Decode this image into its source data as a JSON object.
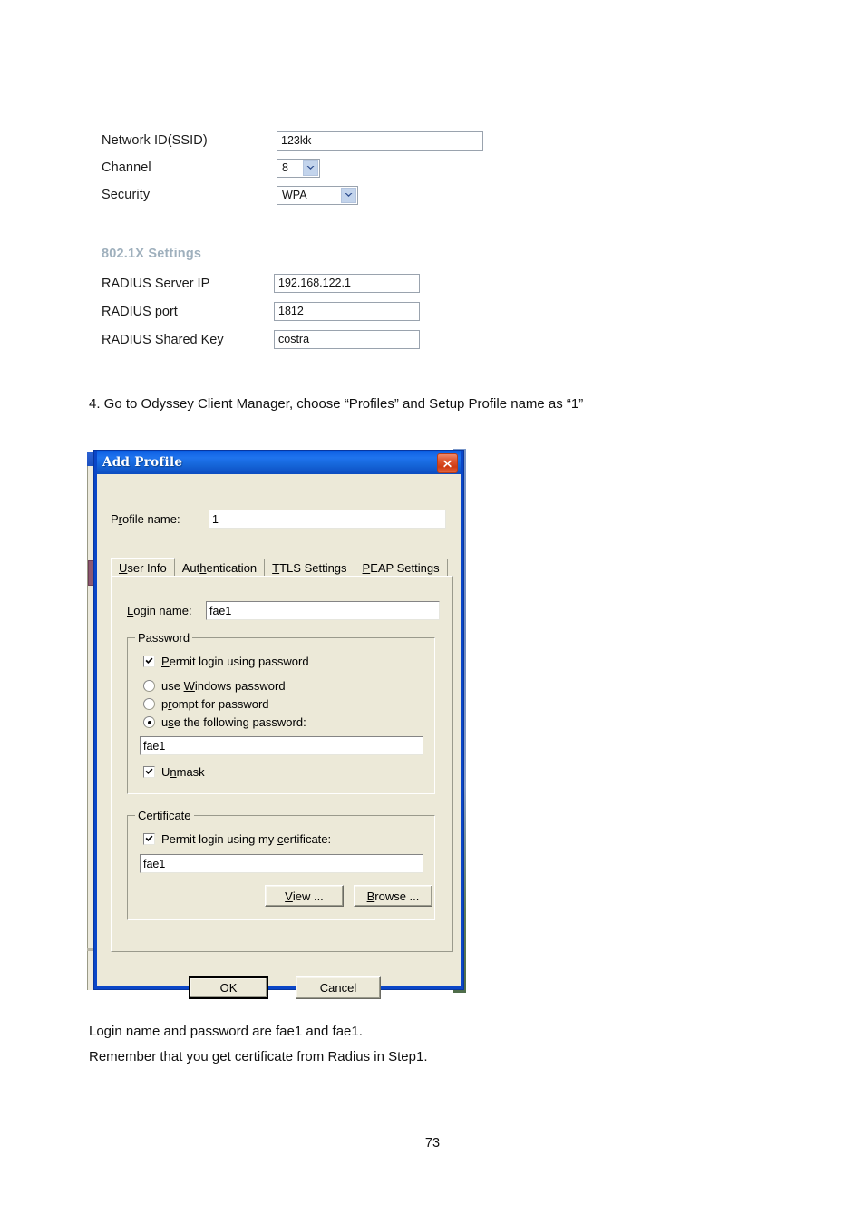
{
  "webform": {
    "rows": [
      {
        "label": "Network ID(SSID)",
        "type": "text",
        "value": "123kk"
      },
      {
        "label": "Channel",
        "type": "select",
        "value": "8"
      },
      {
        "label": "Security",
        "type": "select",
        "value": "WPA"
      }
    ]
  },
  "settings8021x": {
    "title": "802.1X Settings",
    "rows": [
      {
        "label": "RADIUS Server IP",
        "value": "192.168.122.1"
      },
      {
        "label": "RADIUS port",
        "value": "1812"
      },
      {
        "label": "RADIUS Shared Key",
        "value": "costra"
      }
    ]
  },
  "step": {
    "text": "4. Go to Odyssey Client Manager, choose “Profiles” and Setup Profile name as “1”"
  },
  "dialog": {
    "title": "Add Profile",
    "close_label": "Close",
    "profile_name": {
      "label": "Profile name:",
      "label_pre": "P",
      "label_mnemonic": "r",
      "label_post": "ofile name:",
      "value": "1"
    },
    "tabs": [
      {
        "pre": "",
        "mnemonic": "U",
        "post": "ser Info",
        "label": "User Info",
        "active": true
      },
      {
        "pre": "Aut",
        "mnemonic": "h",
        "post": "entication",
        "label": "Authentication",
        "active": false
      },
      {
        "pre": "",
        "mnemonic": "T",
        "post": "TLS Settings",
        "label": "TTLS Settings",
        "active": false
      },
      {
        "pre": "",
        "mnemonic": "P",
        "post": "EAP Settings",
        "label": "PEAP Settings",
        "active": false
      }
    ],
    "login": {
      "label_pre": "",
      "label_mnemonic": "L",
      "label_post": "ogin name:",
      "label": "Login name:",
      "value": "fae1"
    },
    "password_group": {
      "title": "Password",
      "permit_checkbox": {
        "checked": true,
        "pre": "",
        "mnemonic": "P",
        "post": "ermit login using password",
        "label": "Permit login using password"
      },
      "options": [
        {
          "selected": false,
          "pre": "use ",
          "mnemonic": "W",
          "post": "indows password",
          "label": "use Windows password"
        },
        {
          "selected": false,
          "pre": "p",
          "mnemonic": "r",
          "post": "ompt for password",
          "label": "prompt for password"
        },
        {
          "selected": true,
          "pre": "u",
          "mnemonic": "s",
          "post": "e the following password:",
          "label": "use the following password:"
        }
      ],
      "password_value": "fae1",
      "unmask": {
        "checked": true,
        "pre": "U",
        "mnemonic": "n",
        "post": "mask",
        "label": "Unmask"
      }
    },
    "certificate_group": {
      "title": "Certificate",
      "permit_checkbox": {
        "checked": true,
        "pre": "Permit login using my ",
        "mnemonic": "c",
        "post": "ertificate:",
        "label": "Permit login using my certificate:"
      },
      "certificate_value": "fae1",
      "view_button": {
        "pre": "",
        "mnemonic": "V",
        "post": "iew ...",
        "label": "View ..."
      },
      "browse_button": {
        "pre": "",
        "mnemonic": "B",
        "post": "rowse ...",
        "label": "Browse ..."
      }
    },
    "ok_button": "OK",
    "cancel_button": "Cancel"
  },
  "footer": {
    "line1": "Login name and password are fae1 and fae1.",
    "line2": "Remember that you get certificate from Radius in Step1.",
    "page_number": "73"
  },
  "colors": {
    "title_bar_blue": "#1565d8",
    "dialog_face": "#ece9d8",
    "close_red": "#cf3a12",
    "section_title_gray": "#9fb0bd",
    "dropdown_blue": "#c3d4ec"
  }
}
